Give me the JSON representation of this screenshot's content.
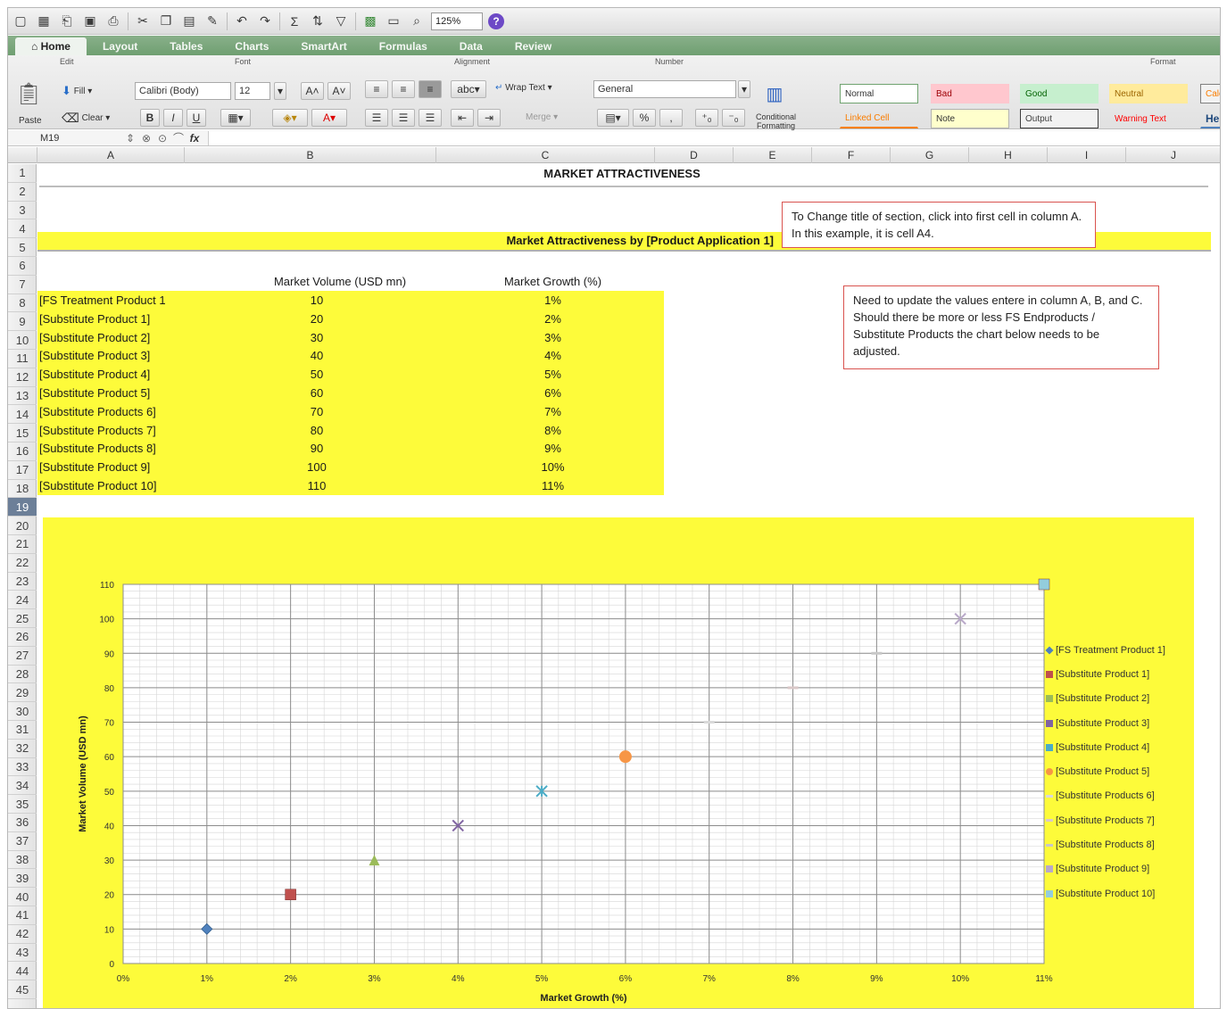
{
  "toolbar": {
    "zoom": "125%",
    "icons": [
      "new-icon",
      "grid-icon",
      "open-icon",
      "save-icon",
      "print-icon",
      "cut-icon",
      "copy-icon",
      "paste-icon",
      "format-painter-icon",
      "undo-icon",
      "redo-icon",
      "autosum-icon",
      "sort-icon",
      "filter-icon",
      "gallery-icon",
      "toolbox-icon",
      "zoom-icon",
      "help-icon"
    ]
  },
  "ribbon": {
    "tabs": [
      "Home",
      "Layout",
      "Tables",
      "Charts",
      "SmartArt",
      "Formulas",
      "Data",
      "Review"
    ],
    "active_tab": "Home",
    "groups": {
      "edit": "Edit",
      "font": "Font",
      "alignment": "Alignment",
      "number": "Number",
      "format": "Format"
    },
    "paste_label": "Paste",
    "fill_label": "Fill",
    "clear_label": "Clear",
    "font_name": "Calibri (Body)",
    "font_size": "12",
    "bold": "B",
    "italic": "I",
    "underline": "U",
    "wrap_text": "Wrap Text",
    "merge": "Merge",
    "abc": "abc",
    "number_format": "General",
    "percent": "%",
    "comma": ",",
    "conditional_formatting": [
      "Conditional",
      "Formatting"
    ],
    "styles": {
      "normal": "Normal",
      "bad": "Bad",
      "good": "Good",
      "neutral": "Neutral",
      "calc": "Calc",
      "linked_cell": "Linked Cell",
      "note": "Note",
      "output": "Output",
      "warning_text": "Warning Text",
      "heading": "He"
    }
  },
  "formula_bar": {
    "name_box": "M19",
    "fx": "fx",
    "value": ""
  },
  "columns": [
    "A",
    "B",
    "C",
    "D",
    "E",
    "F",
    "G",
    "H",
    "I",
    "J"
  ],
  "rows": [
    "1",
    "2",
    "3",
    "4",
    "5",
    "6",
    "7",
    "8",
    "9",
    "10",
    "11",
    "12",
    "13",
    "14",
    "15",
    "16",
    "17",
    "18",
    "19",
    "20",
    "21",
    "22",
    "23",
    "24",
    "25",
    "26",
    "27",
    "28",
    "29",
    "30",
    "31",
    "32",
    "33",
    "34",
    "35",
    "36",
    "37",
    "38",
    "39",
    "40",
    "41",
    "42",
    "43",
    "44",
    "45"
  ],
  "selected_row": "19",
  "sheet": {
    "title": "MARKET ATTRACTIVENESS",
    "section_title": "Market Attractiveness by [Product Application 1]",
    "header_volume": "Market Volume (USD mn)",
    "header_growth": "Market Growth (%)",
    "table": [
      {
        "name": "[FS Treatment Product 1",
        "volume": "10",
        "growth": "1%"
      },
      {
        "name": "[Substitute Product 1]",
        "volume": "20",
        "growth": "2%"
      },
      {
        "name": "[Substitute Product 2]",
        "volume": "30",
        "growth": "3%"
      },
      {
        "name": "[Substitute Product 3]",
        "volume": "40",
        "growth": "4%"
      },
      {
        "name": "[Substitute Product 4]",
        "volume": "50",
        "growth": "5%"
      },
      {
        "name": "[Substitute Product 5]",
        "volume": "60",
        "growth": "6%"
      },
      {
        "name": "[Substitute Products 6]",
        "volume": "70",
        "growth": "7%"
      },
      {
        "name": "[Substitute Products 7]",
        "volume": "80",
        "growth": "8%"
      },
      {
        "name": "[Substitute Products 8]",
        "volume": "90",
        "growth": "9%"
      },
      {
        "name": "[Substitute Product 9]",
        "volume": "100",
        "growth": "10%"
      },
      {
        "name": "[Substitute Product 10]",
        "volume": "110",
        "growth": "11%"
      }
    ],
    "note1": "To Change title of section, click into first cell in column A. In this example, it is cell A4.",
    "note2": "Need to update the values entere in column A, B, and C. Should there be more or less FS Endproducts / Substitute Products the chart below needs to be adjusted."
  },
  "chart_data": {
    "type": "scatter",
    "xlabel": "Market Growth (%)",
    "ylabel": "Market Volume (USD mn)",
    "xlim": [
      0,
      11
    ],
    "ylim": [
      0,
      110
    ],
    "x_ticks": [
      "0%",
      "1%",
      "2%",
      "3%",
      "4%",
      "5%",
      "6%",
      "7%",
      "8%",
      "9%",
      "10%",
      "11%"
    ],
    "y_ticks": [
      "0",
      "10",
      "20",
      "30",
      "40",
      "50",
      "60",
      "70",
      "80",
      "90",
      "100",
      "110"
    ],
    "grid": true,
    "legend_position": "right",
    "series": [
      {
        "name": "[FS Treatment Product 1]",
        "x": 1,
        "y": 10,
        "color": "#4f81bd",
        "marker": "diamond"
      },
      {
        "name": "[Substitute Product 1]",
        "x": 2,
        "y": 20,
        "color": "#c0504d",
        "marker": "square"
      },
      {
        "name": "[Substitute Product 2]",
        "x": 3,
        "y": 30,
        "color": "#9bbb59",
        "marker": "triangle"
      },
      {
        "name": "[Substitute Product 3]",
        "x": 4,
        "y": 40,
        "color": "#8064a2",
        "marker": "x"
      },
      {
        "name": "[Substitute Product 4]",
        "x": 5,
        "y": 50,
        "color": "#4bacc6",
        "marker": "star"
      },
      {
        "name": "[Substitute Product 5]",
        "x": 6,
        "y": 60,
        "color": "#f79646",
        "marker": "circle"
      },
      {
        "name": "[Substitute Products 6]",
        "x": 7,
        "y": 70,
        "color": "#d9d9d9",
        "marker": "dash"
      },
      {
        "name": "[Substitute Products 7]",
        "x": 8,
        "y": 80,
        "color": "#d9c8c8",
        "marker": "dash"
      },
      {
        "name": "[Substitute Products 8]",
        "x": 9,
        "y": 90,
        "color": "#c8c8c8",
        "marker": "dash"
      },
      {
        "name": "[Substitute Product 9]",
        "x": 10,
        "y": 100,
        "color": "#b9a9c9",
        "marker": "x"
      },
      {
        "name": "[Substitute Product 10]",
        "x": 11,
        "y": 110,
        "color": "#93cddd",
        "marker": "square"
      }
    ]
  }
}
